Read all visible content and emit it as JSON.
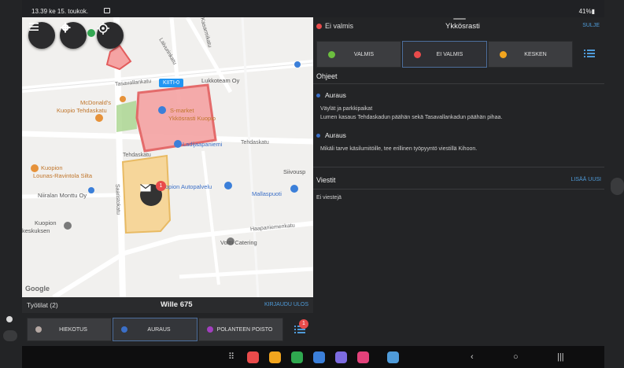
{
  "statusbar": {
    "time": "13.39  ke 15. toukok.",
    "right": "    41%▮"
  },
  "map": {
    "labels": {
      "lukkoteam": "Lukkoteam Oy",
      "mcdonalds_1": "McDonald's",
      "mcdonalds_2": "Kuopio Tehdaskatu",
      "smarket_1": "S-market",
      "smarket_2": "Ykkösrasti Kuopio",
      "ladjaus": "Ladijaapaniemi",
      "kuopion_1": "Kuopion",
      "kuopion_2": "Lounas-Ravintola Silta",
      "niiralan": "Niiralan Monttu Oy",
      "autopalvelu": "opion Autopalvelu",
      "mallaspuoti": "Mallaspuoti",
      "siivous": "Siivousp",
      "kuopion_b1": "Kuopion",
      "kuopion_b2": "keskuksen",
      "voltti": "Voltti Catering",
      "tasavallankatu": "Tasavallankatu",
      "tehdaskatu_1": "Tehdaskatu",
      "tehdaskatu_2": "Tehdaskatu",
      "saaristokatu": "Saaristokatu",
      "laivurinkatu": "Laivurinkatu",
      "haapaniemenkatu": "Haapaniemenkatu",
      "kasarmikatu": "Kasarmikatu"
    },
    "kiiti_tag": "KIITI-0",
    "mail_badge": "1",
    "google": "Google"
  },
  "work_bar": {
    "left": "Työtilat (2)",
    "center": "Wille 675",
    "right": "KIRJAUDU ULOS"
  },
  "tasks": [
    {
      "label": "HIEKOTUS",
      "color": "#b5a8a3"
    },
    {
      "label": "AURAUS",
      "color": "#3b6fc7"
    },
    {
      "label": "POLANTEEN POISTO",
      "color": "#a23fbf"
    }
  ],
  "task_list_badge": "1",
  "panel": {
    "status": "Ei valmis",
    "title": "Ykkösrasti",
    "close": "SULJE",
    "states": [
      {
        "label": "VALMIS",
        "color": "#6cbf3f"
      },
      {
        "label": "EI VALMIS",
        "color": "#e94b4b"
      },
      {
        "label": "KESKEN",
        "color": "#f2a51e"
      }
    ],
    "ohjeet_title": "Ohjeet",
    "instructions": [
      {
        "title": "Auraus",
        "line1": "Väylät ja parkkipaikat",
        "line2": "Lumen kasaus Tehdaskadun päähän sekä Tasavallankadun päähän pihaa."
      },
      {
        "title": "Auraus",
        "line1": "Mikäli tarve käsilumitöille, tee erillinen työpyyntö viestillä Kihoon.",
        "line2": ""
      }
    ],
    "viestit_title": "Viestit",
    "add_new": "LISÄÄ UUSI",
    "no_messages": "Ei viestejä"
  },
  "colors": {
    "accent": "#4f9bd9",
    "red": "#e94b4b"
  }
}
